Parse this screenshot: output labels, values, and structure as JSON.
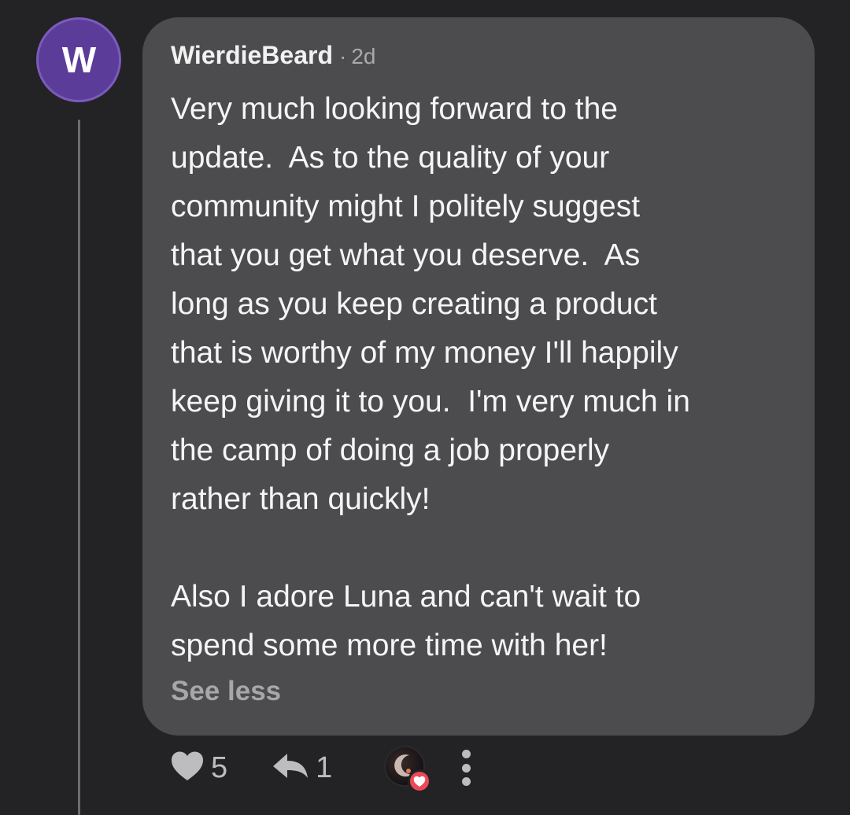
{
  "comment": {
    "avatar_letter": "W",
    "author": "WierdieBeard",
    "separator": "·",
    "time": "2d",
    "body_lines": [
      "Very much looking forward to the",
      "update.  As to the quality of your",
      "community might I politely suggest",
      "that you get what you deserve.  As",
      "long as you keep creating a product",
      "that is worthy of my money I'll happily",
      "keep giving it to you.  I'm very much in",
      "the camp of doing a job properly",
      "rather than quickly!",
      "",
      "Also I adore Luna and can't wait to",
      "spend some more time with her!"
    ],
    "toggle_label": "See less"
  },
  "actions": {
    "like_icon": "heart-icon",
    "like_count": "5",
    "reply_icon": "reply-arrow-icon",
    "reply_count": "1",
    "reaction_icon": "heart-reaction-icon",
    "more_icon": "vertical-dots-icon"
  },
  "colors": {
    "background": "#232224",
    "bubble": "#4c4b4e",
    "avatar": "#5b3c98",
    "heart_reaction": "#ea4a57"
  }
}
